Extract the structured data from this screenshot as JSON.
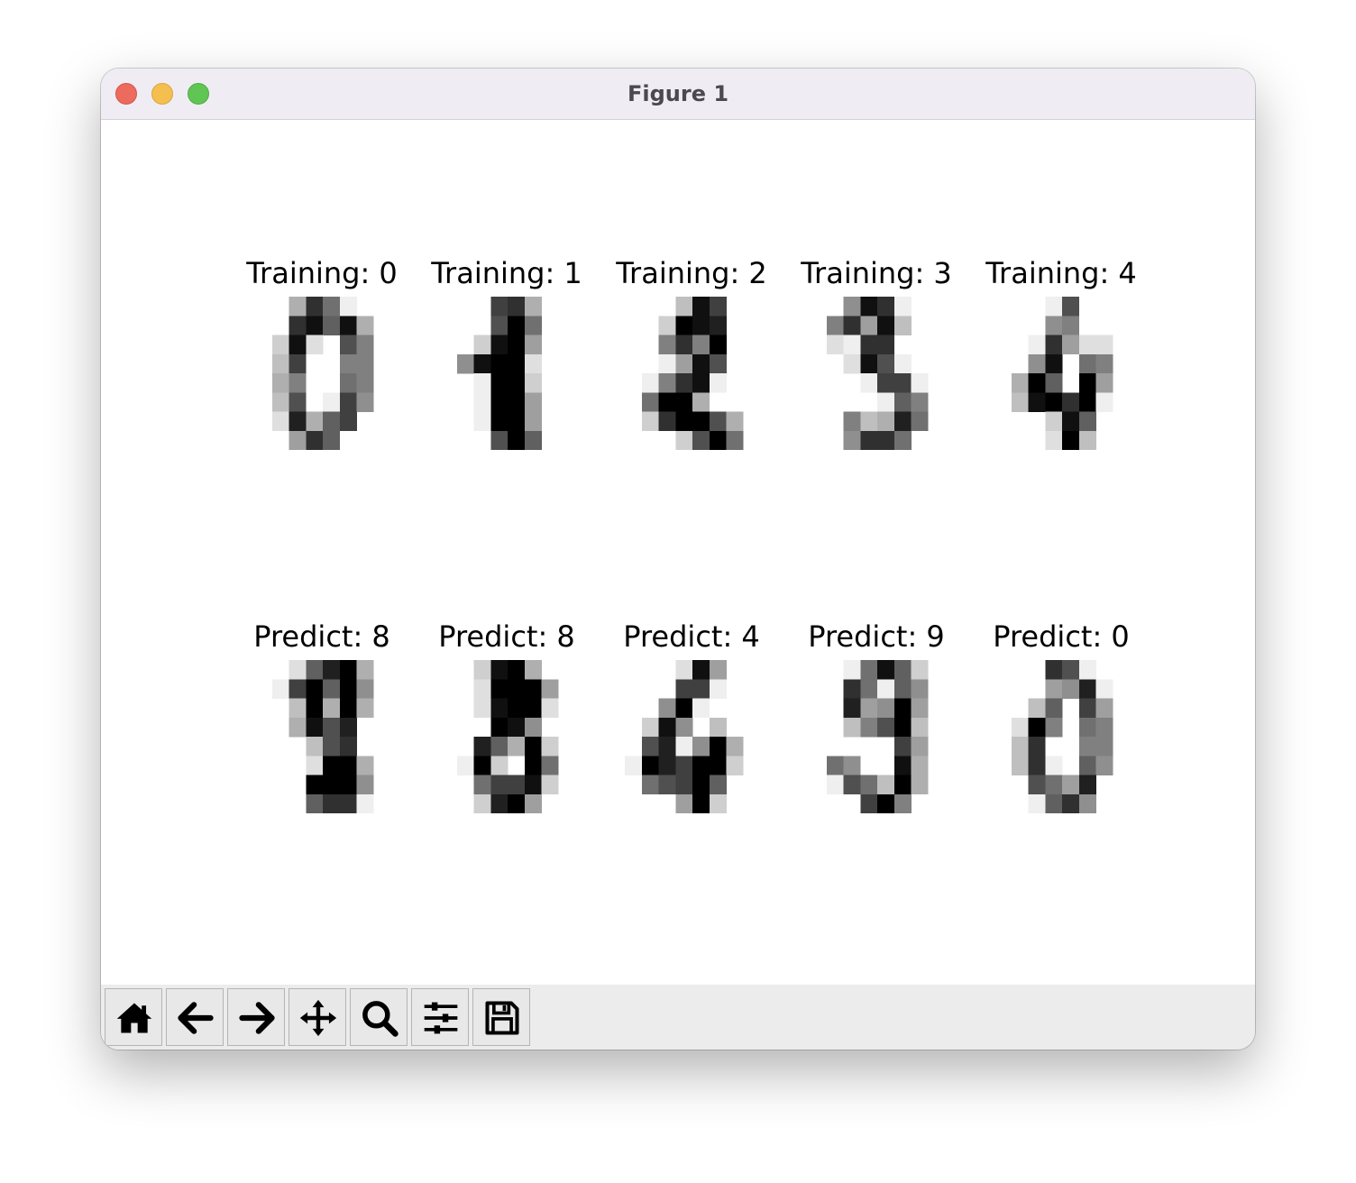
{
  "window": {
    "title": "Figure 1"
  },
  "figure": {
    "subplots": [
      {
        "title": "Training: 0",
        "kind": "training",
        "digit": "0"
      },
      {
        "title": "Training: 1",
        "kind": "training",
        "digit": "1"
      },
      {
        "title": "Training: 2",
        "kind": "training",
        "digit": "2"
      },
      {
        "title": "Training: 3",
        "kind": "training",
        "digit": "3"
      },
      {
        "title": "Training: 4",
        "kind": "training",
        "digit": "4"
      },
      {
        "title": "Predict: 8",
        "kind": "predict",
        "digit": "8"
      },
      {
        "title": "Predict: 8",
        "kind": "predict",
        "digit": "8"
      },
      {
        "title": "Predict: 4",
        "kind": "predict",
        "digit": "4"
      },
      {
        "title": "Predict: 9",
        "kind": "predict",
        "digit": "9"
      },
      {
        "title": "Predict: 0",
        "kind": "predict",
        "digit": "0"
      }
    ],
    "images": [
      [
        [
          0,
          0,
          5,
          13,
          9,
          1,
          0,
          0
        ],
        [
          0,
          0,
          13,
          15,
          10,
          15,
          5,
          0
        ],
        [
          0,
          3,
          15,
          2,
          0,
          11,
          8,
          0
        ],
        [
          0,
          4,
          12,
          0,
          0,
          8,
          8,
          0
        ],
        [
          0,
          5,
          8,
          0,
          0,
          9,
          8,
          0
        ],
        [
          0,
          4,
          11,
          0,
          1,
          12,
          7,
          0
        ],
        [
          0,
          2,
          14,
          5,
          10,
          12,
          0,
          0
        ],
        [
          0,
          0,
          6,
          13,
          10,
          0,
          0,
          0
        ]
      ],
      [
        [
          0,
          0,
          0,
          12,
          13,
          5,
          0,
          0
        ],
        [
          0,
          0,
          0,
          11,
          16,
          9,
          0,
          0
        ],
        [
          0,
          0,
          3,
          15,
          16,
          6,
          0,
          0
        ],
        [
          0,
          7,
          15,
          16,
          16,
          2,
          0,
          0
        ],
        [
          0,
          0,
          1,
          16,
          16,
          3,
          0,
          0
        ],
        [
          0,
          0,
          1,
          16,
          16,
          6,
          0,
          0
        ],
        [
          0,
          0,
          1,
          16,
          16,
          6,
          0,
          0
        ],
        [
          0,
          0,
          0,
          11,
          16,
          10,
          0,
          0
        ]
      ],
      [
        [
          0,
          0,
          0,
          4,
          15,
          12,
          0,
          0
        ],
        [
          0,
          0,
          3,
          16,
          15,
          14,
          0,
          0
        ],
        [
          0,
          0,
          8,
          13,
          8,
          16,
          0,
          0
        ],
        [
          0,
          0,
          1,
          6,
          15,
          11,
          0,
          0
        ],
        [
          0,
          1,
          8,
          13,
          15,
          1,
          0,
          0
        ],
        [
          0,
          9,
          16,
          16,
          5,
          0,
          0,
          0
        ],
        [
          0,
          3,
          13,
          16,
          16,
          11,
          5,
          0
        ],
        [
          0,
          0,
          0,
          3,
          11,
          16,
          9,
          0
        ]
      ],
      [
        [
          0,
          0,
          7,
          15,
          13,
          1,
          0,
          0
        ],
        [
          0,
          8,
          13,
          6,
          15,
          4,
          0,
          0
        ],
        [
          0,
          2,
          1,
          13,
          13,
          0,
          0,
          0
        ],
        [
          0,
          0,
          2,
          15,
          11,
          1,
          0,
          0
        ],
        [
          0,
          0,
          0,
          1,
          12,
          12,
          1,
          0
        ],
        [
          0,
          0,
          0,
          0,
          1,
          10,
          8,
          0
        ],
        [
          0,
          0,
          8,
          4,
          5,
          14,
          9,
          0
        ],
        [
          0,
          0,
          7,
          13,
          13,
          9,
          0,
          0
        ]
      ],
      [
        [
          0,
          0,
          0,
          1,
          11,
          0,
          0,
          0
        ],
        [
          0,
          0,
          0,
          7,
          8,
          0,
          0,
          0
        ],
        [
          0,
          0,
          1,
          13,
          6,
          2,
          2,
          0
        ],
        [
          0,
          0,
          7,
          15,
          0,
          9,
          8,
          0
        ],
        [
          0,
          5,
          16,
          10,
          0,
          16,
          6,
          0
        ],
        [
          0,
          4,
          15,
          16,
          13,
          16,
          1,
          0
        ],
        [
          0,
          0,
          0,
          3,
          15,
          10,
          0,
          0
        ],
        [
          0,
          0,
          0,
          2,
          16,
          4,
          0,
          0
        ]
      ],
      [
        [
          0,
          0,
          2,
          10,
          14,
          16,
          5,
          0
        ],
        [
          0,
          1,
          12,
          16,
          10,
          16,
          7,
          0
        ],
        [
          0,
          0,
          4,
          16,
          5,
          16,
          5,
          0
        ],
        [
          0,
          0,
          5,
          15,
          11,
          14,
          0,
          0
        ],
        [
          0,
          0,
          0,
          4,
          11,
          13,
          0,
          0
        ],
        [
          0,
          0,
          0,
          2,
          16,
          16,
          5,
          0
        ],
        [
          0,
          0,
          0,
          16,
          16,
          16,
          7,
          0
        ],
        [
          0,
          0,
          0,
          10,
          13,
          13,
          1,
          0
        ]
      ],
      [
        [
          0,
          0,
          3,
          15,
          16,
          5,
          0,
          0
        ],
        [
          0,
          0,
          2,
          16,
          16,
          16,
          6,
          0
        ],
        [
          0,
          0,
          2,
          15,
          16,
          16,
          2,
          0
        ],
        [
          0,
          0,
          0,
          16,
          15,
          7,
          0,
          0
        ],
        [
          0,
          0,
          14,
          10,
          5,
          16,
          3,
          0
        ],
        [
          0,
          1,
          16,
          3,
          0,
          16,
          9,
          0
        ],
        [
          0,
          0,
          9,
          12,
          12,
          15,
          3,
          0
        ],
        [
          0,
          0,
          3,
          14,
          16,
          6,
          0,
          0
        ]
      ],
      [
        [
          0,
          0,
          0,
          2,
          15,
          6,
          0,
          0
        ],
        [
          0,
          0,
          0,
          12,
          12,
          1,
          0,
          0
        ],
        [
          0,
          0,
          7,
          16,
          1,
          0,
          0,
          0
        ],
        [
          0,
          3,
          15,
          7,
          0,
          4,
          0,
          0
        ],
        [
          0,
          11,
          14,
          1,
          7,
          16,
          5,
          0
        ],
        [
          1,
          16,
          14,
          12,
          16,
          16,
          3,
          0
        ],
        [
          0,
          9,
          11,
          12,
          16,
          10,
          0,
          0
        ],
        [
          0,
          0,
          0,
          6,
          16,
          3,
          0,
          0
        ]
      ],
      [
        [
          0,
          0,
          1,
          9,
          15,
          10,
          3,
          0
        ],
        [
          0,
          0,
          13,
          9,
          1,
          10,
          7,
          0
        ],
        [
          0,
          0,
          14,
          6,
          7,
          16,
          6,
          0
        ],
        [
          0,
          0,
          4,
          8,
          11,
          16,
          4,
          0
        ],
        [
          0,
          0,
          0,
          0,
          0,
          12,
          6,
          0
        ],
        [
          0,
          9,
          7,
          0,
          0,
          15,
          5,
          0
        ],
        [
          0,
          1,
          11,
          9,
          4,
          16,
          5,
          0
        ],
        [
          0,
          0,
          0,
          12,
          16,
          8,
          0,
          0
        ]
      ],
      [
        [
          0,
          0,
          0,
          13,
          11,
          1,
          0,
          0
        ],
        [
          0,
          0,
          0,
          6,
          7,
          14,
          1,
          0
        ],
        [
          0,
          0,
          4,
          10,
          0,
          12,
          6,
          0
        ],
        [
          0,
          2,
          16,
          8,
          0,
          9,
          8,
          0
        ],
        [
          0,
          4,
          13,
          0,
          0,
          8,
          8,
          0
        ],
        [
          0,
          4,
          13,
          1,
          0,
          10,
          7,
          0
        ],
        [
          0,
          0,
          11,
          9,
          6,
          14,
          0,
          0
        ],
        [
          0,
          0,
          1,
          10,
          13,
          7,
          0,
          0
        ]
      ]
    ]
  }
}
